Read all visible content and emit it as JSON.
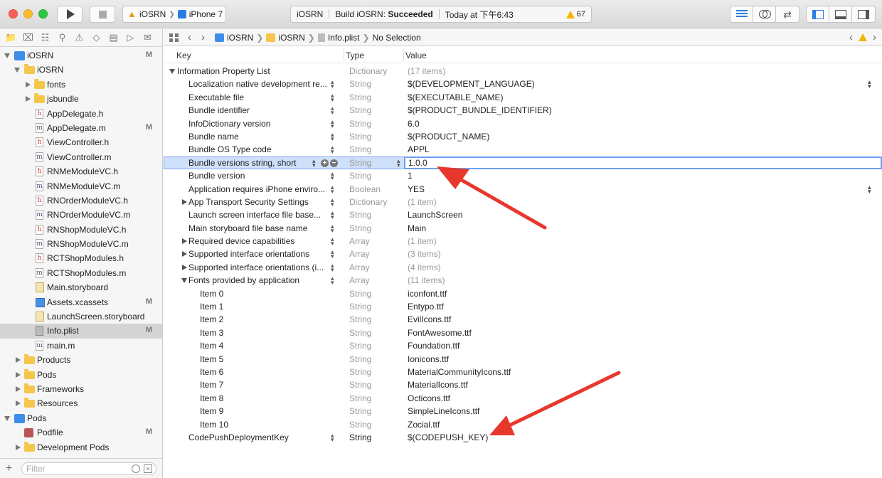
{
  "toolbar": {
    "scheme_app": "iOSRN",
    "scheme_device": "iPhone 7",
    "status_project": "iOSRN",
    "status_build_prefix": "Build iOSRN: ",
    "status_build_result": "Succeeded",
    "status_time": "Today at 下午6:43",
    "warning_count": "67"
  },
  "navigator": {
    "filter_placeholder": "Filter",
    "items": [
      {
        "label": "iOSRN",
        "badge": "M"
      },
      {
        "label": "iOSRN",
        "badge": ""
      },
      {
        "label": "fonts",
        "badge": ""
      },
      {
        "label": "jsbundle",
        "badge": ""
      },
      {
        "label": "AppDelegate.h",
        "badge": ""
      },
      {
        "label": "AppDelegate.m",
        "badge": "M"
      },
      {
        "label": "ViewController.h",
        "badge": ""
      },
      {
        "label": "ViewController.m",
        "badge": ""
      },
      {
        "label": "RNMeModuleVC.h",
        "badge": ""
      },
      {
        "label": "RNMeModuleVC.m",
        "badge": ""
      },
      {
        "label": "RNOrderModuleVC.h",
        "badge": ""
      },
      {
        "label": "RNOrderModuleVC.m",
        "badge": ""
      },
      {
        "label": "RNShopModuleVC.h",
        "badge": ""
      },
      {
        "label": "RNShopModuleVC.m",
        "badge": ""
      },
      {
        "label": "RCTShopModules.h",
        "badge": ""
      },
      {
        "label": "RCTShopModules.m",
        "badge": ""
      },
      {
        "label": "Main.storyboard",
        "badge": ""
      },
      {
        "label": "Assets.xcassets",
        "badge": "M"
      },
      {
        "label": "LaunchScreen.storyboard",
        "badge": ""
      },
      {
        "label": "Info.plist",
        "badge": "M"
      },
      {
        "label": "main.m",
        "badge": ""
      },
      {
        "label": "Products",
        "badge": ""
      },
      {
        "label": "Pods",
        "badge": ""
      },
      {
        "label": "Frameworks",
        "badge": ""
      },
      {
        "label": "Resources",
        "badge": ""
      },
      {
        "label": "Pods",
        "badge": ""
      },
      {
        "label": "Podfile",
        "badge": "M"
      },
      {
        "label": "Development Pods",
        "badge": ""
      }
    ]
  },
  "jumpbar": {
    "crumbs": [
      "iOSRN",
      "iOSRN",
      "Info.plist",
      "No Selection"
    ]
  },
  "plist": {
    "headers": {
      "key": "Key",
      "type": "Type",
      "value": "Value"
    },
    "rows": [
      {
        "key": "Information Property List",
        "type": "Dictionary",
        "value": "(17 items)"
      },
      {
        "key": "Localization native development re...",
        "type": "String",
        "value": "$(DEVELOPMENT_LANGUAGE)"
      },
      {
        "key": "Executable file",
        "type": "String",
        "value": "$(EXECUTABLE_NAME)"
      },
      {
        "key": "Bundle identifier",
        "type": "String",
        "value": "$(PRODUCT_BUNDLE_IDENTIFIER)"
      },
      {
        "key": "InfoDictionary version",
        "type": "String",
        "value": "6.0"
      },
      {
        "key": "Bundle name",
        "type": "String",
        "value": "$(PRODUCT_NAME)"
      },
      {
        "key": "Bundle OS Type code",
        "type": "String",
        "value": "APPL"
      },
      {
        "key": "Bundle versions string, short",
        "type": "String",
        "value": "1.0.0"
      },
      {
        "key": "Bundle version",
        "type": "String",
        "value": "1"
      },
      {
        "key": "Application requires iPhone enviro...",
        "type": "Boolean",
        "value": "YES"
      },
      {
        "key": "App Transport Security Settings",
        "type": "Dictionary",
        "value": "(1 item)"
      },
      {
        "key": "Launch screen interface file base...",
        "type": "String",
        "value": "LaunchScreen"
      },
      {
        "key": "Main storyboard file base name",
        "type": "String",
        "value": "Main"
      },
      {
        "key": "Required device capabilities",
        "type": "Array",
        "value": "(1 item)"
      },
      {
        "key": "Supported interface orientations",
        "type": "Array",
        "value": "(3 items)"
      },
      {
        "key": "Supported interface orientations (i...",
        "type": "Array",
        "value": "(4 items)"
      },
      {
        "key": "Fonts provided by application",
        "type": "Array",
        "value": "(11 items)"
      },
      {
        "key": "Item 0",
        "type": "String",
        "value": "iconfont.ttf"
      },
      {
        "key": "Item 1",
        "type": "String",
        "value": "Entypo.ttf"
      },
      {
        "key": "Item 2",
        "type": "String",
        "value": "EvilIcons.ttf"
      },
      {
        "key": "Item 3",
        "type": "String",
        "value": "FontAwesome.ttf"
      },
      {
        "key": "Item 4",
        "type": "String",
        "value": "Foundation.ttf"
      },
      {
        "key": "Item 5",
        "type": "String",
        "value": "Ionicons.ttf"
      },
      {
        "key": "Item 6",
        "type": "String",
        "value": "MaterialCommunityIcons.ttf"
      },
      {
        "key": "Item 7",
        "type": "String",
        "value": "MaterialIcons.ttf"
      },
      {
        "key": "Item 8",
        "type": "String",
        "value": "Octicons.ttf"
      },
      {
        "key": "Item 9",
        "type": "String",
        "value": "SimpleLineIcons.ttf"
      },
      {
        "key": "Item 10",
        "type": "String",
        "value": "Zocial.ttf"
      },
      {
        "key": "CodePushDeploymentKey",
        "type": "String",
        "value": "$(CODEPUSH_KEY)"
      }
    ]
  },
  "colors": {
    "accent": "#2a7de1",
    "annotation_arrow": "#e8372c",
    "warning": "#f5b400"
  }
}
